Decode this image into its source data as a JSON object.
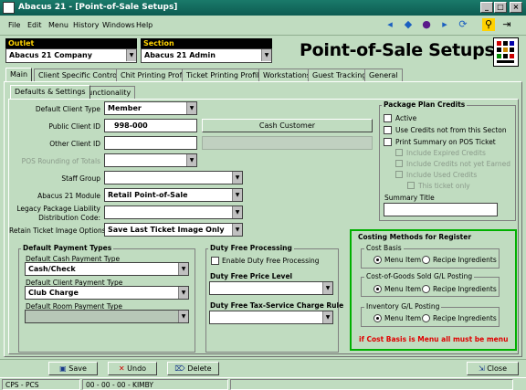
{
  "window": {
    "title": "Abacus 21 - [Point-of-Sale Setups]"
  },
  "menu": [
    "File",
    "Edit",
    "Menu",
    "History",
    "Windows",
    "Help"
  ],
  "header": {
    "outlet_label": "Outlet",
    "outlet_value": "Abacus 21 Company",
    "section_label": "Section",
    "section_value": "Abacus 21 Admin",
    "page_title": "Point-of-Sale Setups"
  },
  "tabs": [
    "Main",
    "Client Specific Controls",
    "Chit Printing Profile",
    "Ticket Printing Profiles",
    "Workstations",
    "Guest Tracking",
    "General"
  ],
  "subtabs": [
    "Defaults & Settings",
    "Functionality"
  ],
  "form": {
    "default_client_type_label": "Default Client Type",
    "default_client_type_value": "Member",
    "public_client_id_label": "Public Client ID",
    "public_client_id_value": "998-000",
    "public_client_name": "Cash  Customer",
    "other_client_id_label": "Other Client ID",
    "pos_rounding_label": "POS Rounding of Totals",
    "staff_group_label": "Staff Group",
    "module_label": "Abacus 21 Module",
    "module_value": "Retail Point-of-Sale",
    "legacy_label_1": "Legacy Package Liability",
    "legacy_label_2": "Distribution Code:",
    "retain_label": "Retain Ticket Image Options",
    "retain_value": "Save Last Ticket Image Only"
  },
  "package_plan": {
    "title": "Package Plan Credits",
    "active": "Active",
    "use_credits": "Use Credits not from this Secton",
    "print_summary": "Print Summary on POS Ticket",
    "include_expired": "Include Expired Credits",
    "include_not_earned": "Include Credits not yet Earned",
    "include_used": "Include Used Credits",
    "this_ticket_only": "This ticket only",
    "summary_title_label": "Summary Title"
  },
  "default_payment": {
    "title": "Default Payment Types",
    "cash_label": "Default Cash Payment Type",
    "cash_value": "Cash/Check",
    "client_label": "Default Client Payment Type",
    "client_value": "Club Charge",
    "room_label": "Default Room Payment Type"
  },
  "duty_free": {
    "title": "Duty Free Processing",
    "enable": "Enable Duty Free Processing",
    "price_level_label": "Duty Free Price Level",
    "tax_rule_label": "Duty Free Tax-Service Charge Rule"
  },
  "costing": {
    "title": "Costing Methods for Register",
    "cost_basis": "Cost Basis",
    "cogs": "Cost-of-Goods Sold G/L Posting",
    "inventory": "Inventory G/L Posting",
    "menu_item": "Menu Item",
    "recipe_ingredients": "Recipe Ingredients",
    "warning": "if Cost Basis is Menu all must be menu"
  },
  "buttons": {
    "save": "Save",
    "undo": "Undo",
    "delete": "Delete",
    "close": "Close"
  },
  "status": {
    "left": "CPS - PCS",
    "middle": "00 - 00 - 00 - KIMBY"
  },
  "colors": {
    "background": "#c0dcc0",
    "titlebar": "#0d5c52",
    "header_label": "#ffd200",
    "warning": "#e00000"
  }
}
